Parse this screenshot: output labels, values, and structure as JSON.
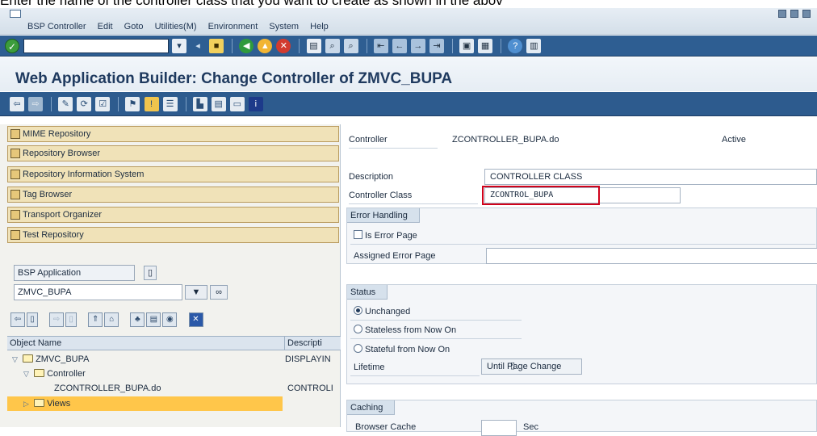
{
  "caption": "Enter the name of the controller class that you want to create as shown in the abov",
  "menu": [
    "BSP Controller",
    "Edit",
    "Goto",
    "Utilities(M)",
    "Environment",
    "System",
    "Help"
  ],
  "title": "Web Application Builder: Change Controller of ZMVC_BUPA",
  "nav": {
    "buttons": [
      "MIME Repository",
      "Repository Browser",
      "Repository Information System",
      "Tag Browser",
      "Transport Organizer",
      "Test Repository"
    ],
    "object_type": "BSP Application",
    "object_name": "ZMVC_BUPA",
    "tree_headers": {
      "name": "Object Name",
      "desc": "Descripti"
    },
    "tree": [
      {
        "name": "ZMVC_BUPA",
        "desc": "DISPLAYIN"
      },
      {
        "name": "Controller",
        "desc": ""
      },
      {
        "name": "ZCONTROLLER_BUPA.do",
        "desc": "CONTROLI"
      },
      {
        "name": "Views",
        "desc": ""
      }
    ]
  },
  "props": {
    "controller_label": "Controller",
    "controller_value": "ZCONTROLLER_BUPA.do",
    "status": "Active",
    "description_label": "Description",
    "description_value": "CONTROLLER CLASS",
    "class_label": "Controller Class",
    "class_value": "ZCONTROL_BUPA",
    "error_handling": {
      "title": "Error Handling",
      "is_error_page": "Is Error Page",
      "assigned_label": "Assigned Error Page",
      "assigned_value": ""
    },
    "status_group": {
      "title": "Status",
      "options": [
        "Unchanged",
        "Stateless from Now On",
        "Stateful from Now On"
      ],
      "selected": "Unchanged",
      "lifetime_label": "Lifetime",
      "lifetime_value": "Until Page Change"
    },
    "caching": {
      "title": "Caching",
      "browser_cache_label": "Browser Cache",
      "browser_cache_unit": "Sec"
    }
  },
  "colors": {
    "toolbar_blue": "#2e5e92",
    "nav_button": "#f0e2b8",
    "selected_row": "#ffc64a",
    "highlight_red": "#d0021b"
  }
}
